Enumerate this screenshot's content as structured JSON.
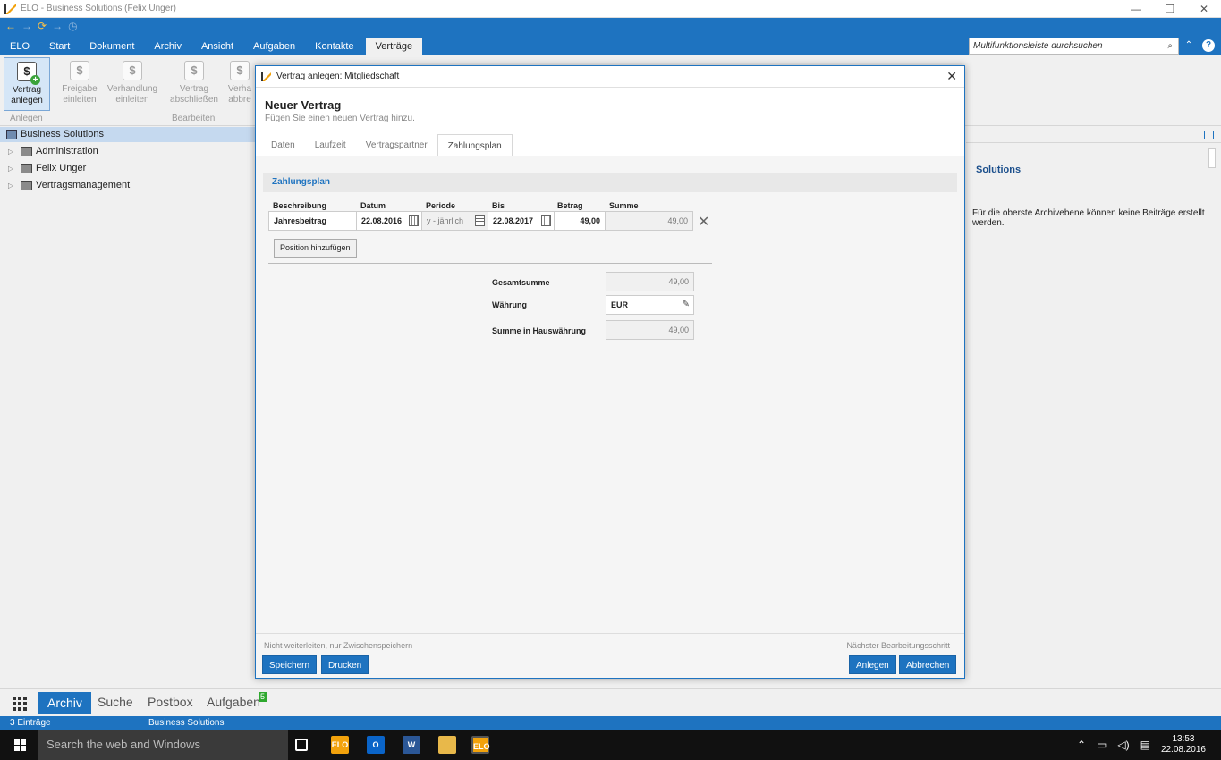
{
  "window": {
    "title": "ELO - Business Solutions (Felix Unger)",
    "controls": [
      "—",
      "❐",
      "✕"
    ]
  },
  "ribbon_tabs": [
    "ELO",
    "Start",
    "Dokument",
    "Archiv",
    "Ansicht",
    "Aufgaben",
    "Kontakte",
    "Verträge"
  ],
  "active_tab": "Verträge",
  "ribbon_search": {
    "placeholder": "Multifunktionsleiste durchsuchen"
  },
  "ribbon": {
    "buttons": [
      {
        "label": "Vertrag anlegen",
        "icon": "contract-add-icon"
      },
      {
        "label": "Freigabe einleiten",
        "icon": "contract-release-icon"
      },
      {
        "label": "Verhandlung einleiten",
        "icon": "contract-negotiation-icon"
      },
      {
        "label": "Vertrag abschließen",
        "icon": "contract-close-icon"
      },
      {
        "label": "Verha abbre",
        "icon": "contract-cancel-icon"
      }
    ],
    "groups": [
      "Anlegen",
      "Bearbeiten"
    ]
  },
  "tree": {
    "root": "Business Solutions",
    "items": [
      "Administration",
      "Felix Unger",
      "Vertragsmanagement"
    ]
  },
  "right_panel": {
    "title": "Solutions",
    "message": "Für die oberste Archivebene können keine Beiträge erstellt werden."
  },
  "bottom_nav": {
    "items": [
      "Archiv",
      "Suche",
      "Postbox",
      "Aufgaben"
    ],
    "active": "Archiv",
    "badge": "5"
  },
  "statusbar": {
    "count": "3 Einträge",
    "location": "Business Solutions"
  },
  "taskbar": {
    "search_placeholder": "Search the web and Windows",
    "time": "13:53",
    "date": "22.08.2016"
  },
  "dialog": {
    "title": "Vertrag anlegen: Mitgliedschaft",
    "heading": "Neuer Vertrag",
    "subheading": "Fügen Sie einen neuen Vertrag hinzu.",
    "tabs": [
      "Daten",
      "Laufzeit",
      "Vertragspartner",
      "Zahlungsplan"
    ],
    "active_tab": "Zahlungsplan",
    "section": "Zahlungsplan",
    "columns": [
      "Beschreibung",
      "Datum",
      "Periode",
      "Bis",
      "Betrag",
      "Summe"
    ],
    "row": {
      "beschreibung": "Jahresbeitrag",
      "datum": "22.08.2016",
      "periode": "y - jährlich",
      "bis": "22.08.2017",
      "betrag": "49,00",
      "summe": "49,00"
    },
    "add_position": "Position hinzufügen",
    "totals": {
      "gesamtsumme_label": "Gesamtsumme",
      "gesamtsumme": "49,00",
      "waehrung_label": "Währung",
      "waehrung": "EUR",
      "hauswaehrung_label": "Summe in Hauswährung",
      "hauswaehrung": "49,00"
    },
    "footer": {
      "left_hint": "Nicht weiterleiten, nur Zwischenspeichern",
      "right_hint": "Nächster Bearbeitungsschritt",
      "save": "Speichern",
      "print": "Drucken",
      "create": "Anlegen",
      "cancel": "Abbrechen"
    }
  },
  "colors": {
    "accent": "#1e73c0",
    "ribbon_bg": "#f0f0f0",
    "badge": "#2ea82e"
  }
}
